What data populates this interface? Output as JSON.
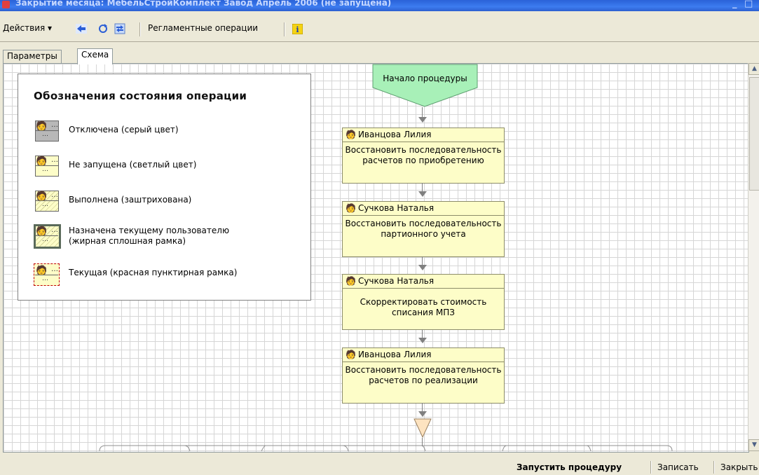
{
  "window": {
    "title": "Закрытие месяца: МебельСтройКомплект Завод Апрель 2006 (не запущена)",
    "minimize": "_",
    "maximize": "□"
  },
  "toolbar": {
    "actions_label": "Действия ▾",
    "regulated_ops_label": "Регламентные операции"
  },
  "tabs": [
    {
      "label": "Параметры",
      "active": false
    },
    {
      "label": "Схема",
      "active": true
    }
  ],
  "legend": {
    "title": "Обозначения состояния операции",
    "items": [
      {
        "label": "Отключена (серый цвет)",
        "state": "disabled"
      },
      {
        "label": "Не запущена (светлый цвет)",
        "state": "not-started"
      },
      {
        "label": "Выполнена (заштрихована)",
        "state": "done"
      },
      {
        "label": "Назначена текущему пользователю\n(жирная сплошная рамка)",
        "state": "assigned"
      },
      {
        "label": "Текущая (красная пунктирная рамка)",
        "state": "current"
      }
    ]
  },
  "flow": {
    "start_label": "Начало процедуры",
    "nodes": [
      {
        "user": "Иванцова Лилия",
        "task": "Восстановить последовательность расчетов по приобретению"
      },
      {
        "user": "Сучкова Наталья",
        "task": "Восстановить последовательность партионного учета"
      },
      {
        "user": "Сучкова Наталья",
        "task": "Скорректировать стоимость списания МПЗ"
      },
      {
        "user": "Иванцова Лилия",
        "task": "Восстановить последовательность расчетов по реализации"
      }
    ]
  },
  "statusbar": {
    "run_label": "Запустить процедуру",
    "save_label": "Записать",
    "close_label": "Закрыть"
  },
  "colors": {
    "node_fill": "#fdfdc8",
    "start_fill": "#a8f0b8",
    "grid": "#d6d6d6",
    "current_border": "#c00000"
  }
}
